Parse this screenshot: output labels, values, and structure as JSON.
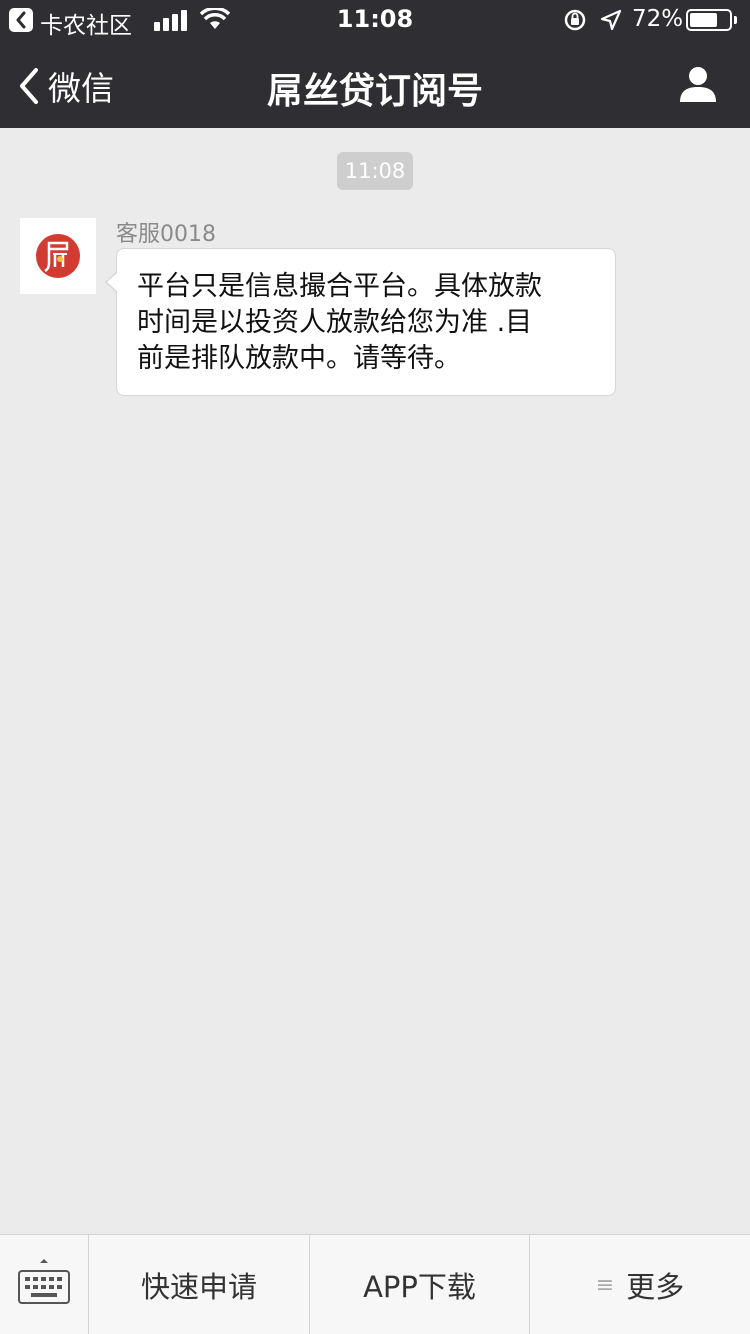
{
  "status_bar": {
    "carrier": "卡农社区",
    "time": "11:08",
    "battery_percent": "72%",
    "battery_level": 0.72
  },
  "nav": {
    "back_label": "微信",
    "title": "屌丝贷订阅号"
  },
  "chat": {
    "timestamp": "11:08",
    "sender": "客服0018",
    "message": "平台只是信息撮合平台。具体放款\n时间是以投资人放款给您为准 .目\n前是排队放款中。请等待。"
  },
  "bottom_menu": {
    "item1": "快速申请",
    "item2": "APP下载",
    "item3_icon": "≡",
    "item3": "更多"
  },
  "colors": {
    "header_bg": "#2e2e33",
    "chat_bg": "#ebebeb",
    "avatar_red": "#d23b32"
  }
}
